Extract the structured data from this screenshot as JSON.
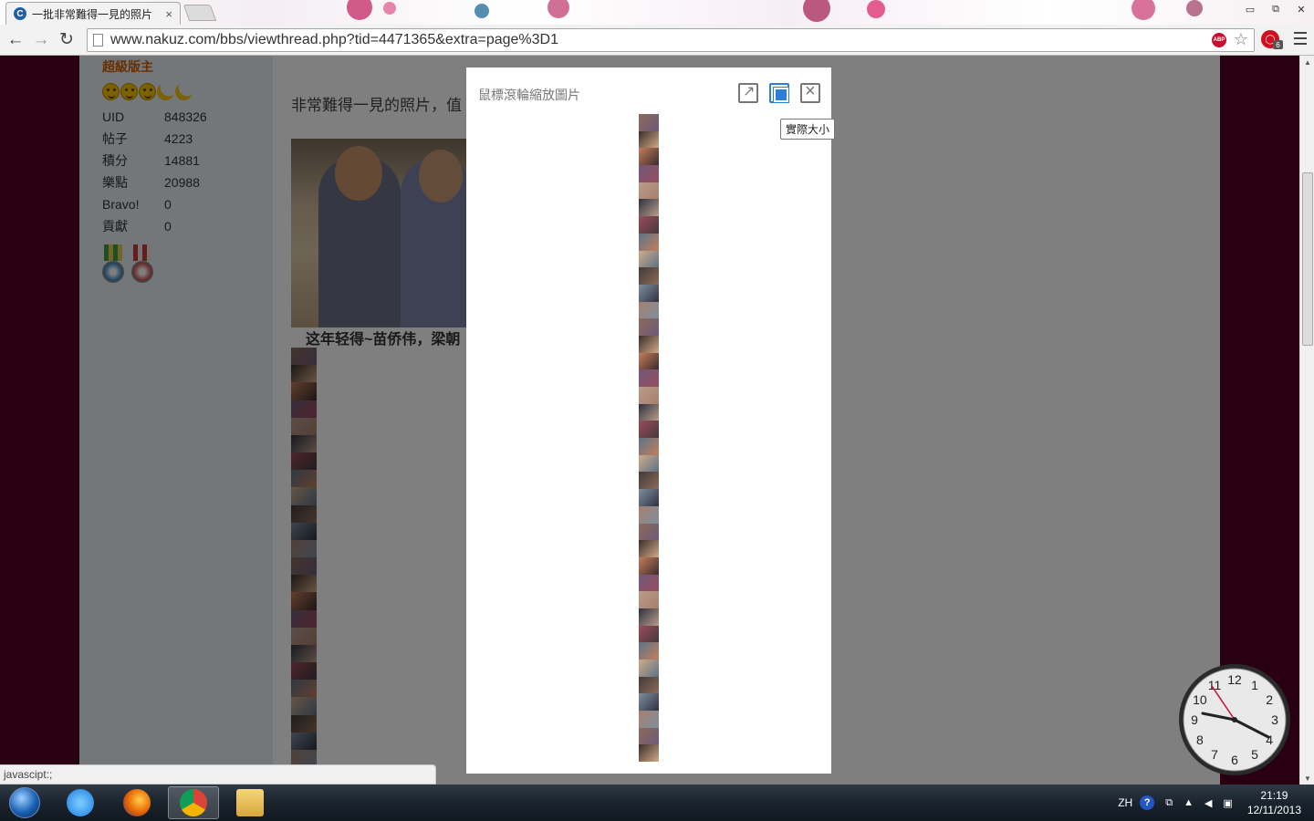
{
  "browser": {
    "tab_title": "一批非常難得一見的照片",
    "tab_close": "×",
    "url": "www.nakuz.com/bbs/viewthread.php?tid=4471365&extra=page%3D1",
    "back": "←",
    "forward": "→",
    "reload": "↻",
    "abp_label": "ABP",
    "ext_badge": "6",
    "win_min": "▭",
    "win_restore": "⧉",
    "win_close": "✕"
  },
  "profile": {
    "rank": "超級版主",
    "stats": [
      {
        "label": "UID",
        "value": "848326"
      },
      {
        "label": "帖子",
        "value": "4223"
      },
      {
        "label": "積分",
        "value": "14881"
      },
      {
        "label": "樂點",
        "value": "20988"
      },
      {
        "label": "Bravo!",
        "value": "0"
      },
      {
        "label": "貢獻",
        "value": "0"
      }
    ],
    "medal_colors": [
      "#2e86c1",
      "#d14a4a"
    ]
  },
  "post": {
    "title": "非常難得一見的照片，值",
    "caption": "这年轻得~苗侨伟，梁朝"
  },
  "lightbox": {
    "hint": "鼠標滾輪縮放圖片",
    "tooltip": "實際大小",
    "btn_open": "open-in-new-window-icon",
    "btn_actual": "actual-size-icon",
    "btn_close": "close-icon"
  },
  "status_text": "javascipt:;",
  "taskbar": {
    "lang": "ZH",
    "time": "21:19",
    "date": "12/11/2013"
  },
  "gadget": {
    "numbers": [
      "12",
      "1",
      "2",
      "3",
      "4",
      "5",
      "6",
      "7",
      "8",
      "9",
      "10",
      "11"
    ]
  },
  "colors": {
    "page_bg": "#500022",
    "rank": "#d35d00",
    "accent": "#2b7fd6"
  }
}
